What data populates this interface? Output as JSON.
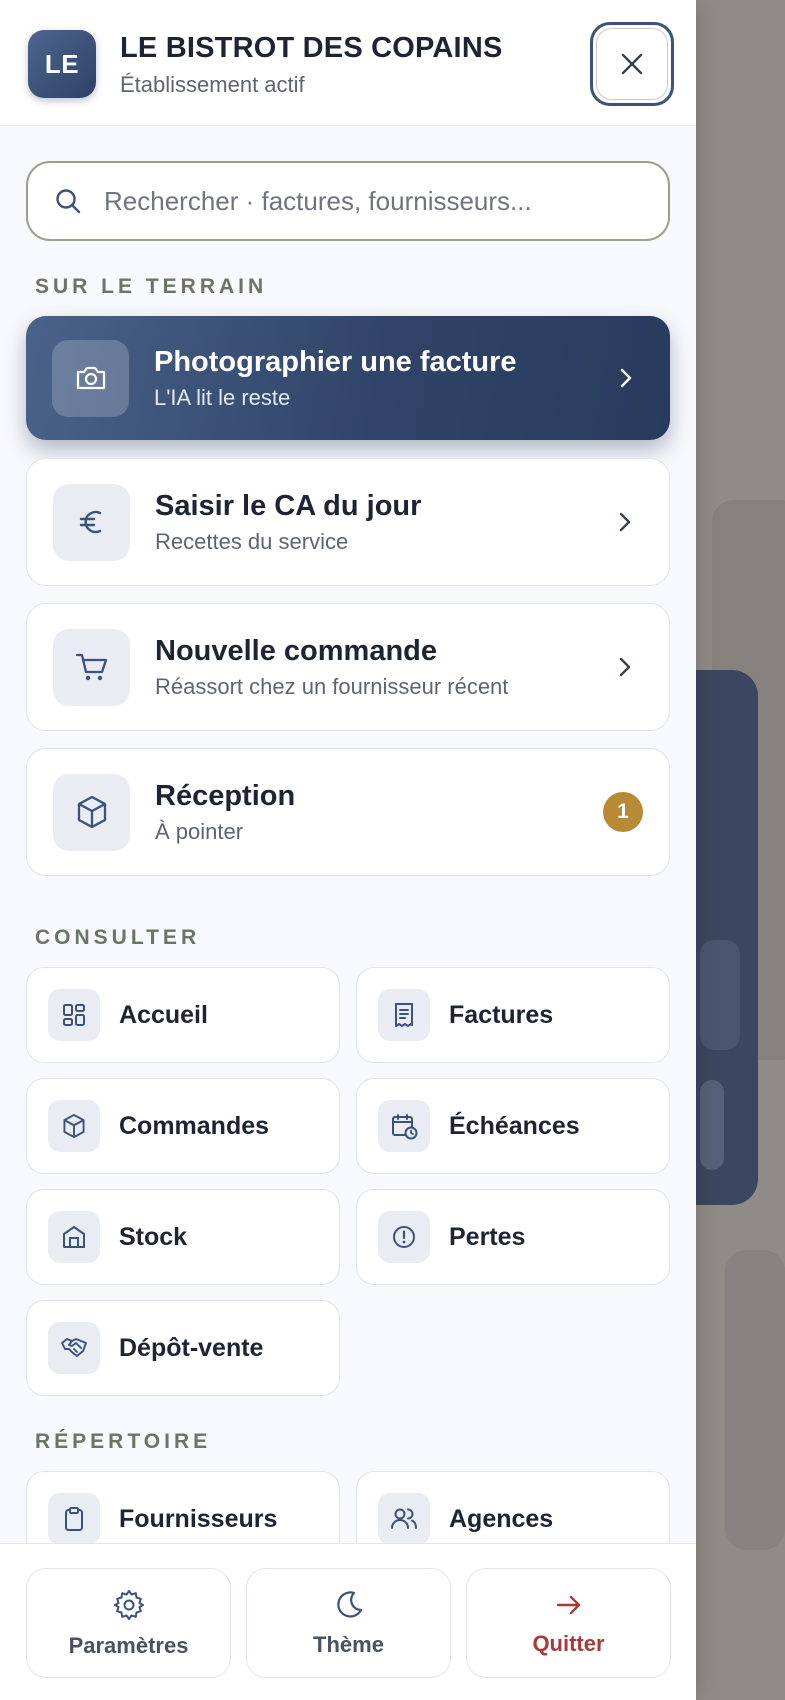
{
  "header": {
    "logo_initials": "LE",
    "establishment_name": "LE BISTROT DES COPAINS",
    "establishment_status": "Établissement actif"
  },
  "search": {
    "placeholder": "Rechercher · factures, fournisseurs..."
  },
  "sections": {
    "field": "SUR LE TERRAIN",
    "consult": "CONSULTER",
    "directory": "RÉPERTOIRE"
  },
  "actions": [
    {
      "title": "Photographier une facture",
      "subtitle": "L'IA lit le reste",
      "icon": "camera-icon"
    },
    {
      "title": "Saisir le CA du jour",
      "subtitle": "Recettes du service",
      "icon": "euro-icon"
    },
    {
      "title": "Nouvelle commande",
      "subtitle": "Réassort chez un fournisseur récent",
      "icon": "cart-icon"
    },
    {
      "title": "Réception",
      "subtitle": "À pointer",
      "icon": "box-icon",
      "badge": "1"
    }
  ],
  "consult_items": [
    {
      "label": "Accueil",
      "icon": "dashboard-icon"
    },
    {
      "label": "Factures",
      "icon": "receipt-icon"
    },
    {
      "label": "Commandes",
      "icon": "box-icon"
    },
    {
      "label": "Échéances",
      "icon": "calendar-clock-icon"
    },
    {
      "label": "Stock",
      "icon": "warehouse-icon"
    },
    {
      "label": "Pertes",
      "icon": "alert-circle-icon"
    },
    {
      "label": "Dépôt-vente",
      "icon": "handshake-icon"
    }
  ],
  "directory_items": [
    {
      "label": "Fournisseurs",
      "icon": "clipboard-icon"
    },
    {
      "label": "Agences",
      "icon": "users-icon"
    }
  ],
  "footer": {
    "settings": "Paramètres",
    "theme": "Thème",
    "quit": "Quitter"
  },
  "colors": {
    "primary": "#2f4468",
    "badge": "#b88a35",
    "danger": "#a93a3a",
    "icon": "#3b527c"
  }
}
